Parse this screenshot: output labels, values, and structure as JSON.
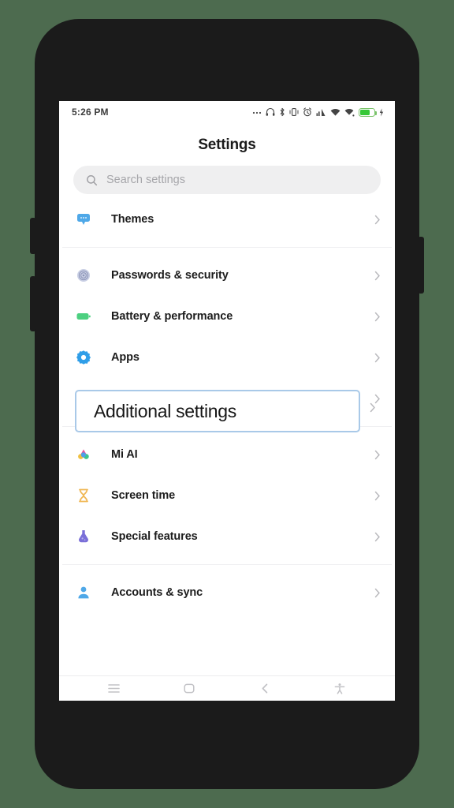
{
  "device": {
    "frame_color": "#1b1b1b",
    "background_color": "#4d6b4f"
  },
  "status_bar": {
    "time": "5:26 PM",
    "icons": [
      "more-ellipsis-icon",
      "headphones-icon",
      "bluetooth-icon",
      "vibrate-icon",
      "alarm-icon",
      "signal-icon",
      "wifi-icon",
      "wifi-calling-icon",
      "battery-icon",
      "charging-bolt-icon"
    ],
    "battery_color": "#37c837",
    "battery_level_percent": 72
  },
  "header": {
    "title": "Settings"
  },
  "search": {
    "placeholder": "Search settings",
    "icon": "search-icon",
    "value": ""
  },
  "list": {
    "groups": [
      {
        "items": [
          {
            "label": "Themes",
            "icon": "themes-icon",
            "icon_color": "#4fa8e8",
            "chevron": "chevron-right-icon"
          }
        ]
      },
      {
        "items": [
          {
            "label": "Passwords & security",
            "icon": "fingerprint-icon",
            "icon_color": "#9aa3c4",
            "chevron": "chevron-right-icon"
          },
          {
            "label": "Battery & performance",
            "icon": "battery-icon",
            "icon_color": "#4cd080",
            "chevron": "chevron-right-icon"
          },
          {
            "label": "Apps",
            "icon": "gear-icon",
            "icon_color": "#2f9ee8",
            "chevron": "chevron-right-icon"
          },
          {
            "label": "Additional settings",
            "icon": "sliders-icon",
            "icon_color": "#6fb7e8",
            "chevron": "chevron-right-icon"
          }
        ]
      },
      {
        "items": [
          {
            "label": "Mi AI",
            "icon": "mi-ai-icon",
            "icon_color": "#e8559a",
            "chevron": "chevron-right-icon"
          },
          {
            "label": "Screen time",
            "icon": "hourglass-icon",
            "icon_color": "#f0b856",
            "chevron": "chevron-right-icon"
          },
          {
            "label": "Special features",
            "icon": "flask-icon",
            "icon_color": "#7a6fd8",
            "chevron": "chevron-right-icon"
          }
        ]
      },
      {
        "items": [
          {
            "label": "Accounts & sync",
            "icon": "account-icon",
            "icon_color": "#4fa8e8",
            "chevron": "chevron-right-icon"
          }
        ]
      }
    ]
  },
  "highlight": {
    "label": "Additional settings",
    "border_color": "#a9c9e8",
    "chevron": "chevron-right-icon"
  },
  "navbar": {
    "buttons": [
      {
        "name": "recents-button",
        "icon": "menu-icon"
      },
      {
        "name": "home-button",
        "icon": "home-square-icon"
      },
      {
        "name": "back-button",
        "icon": "chevron-left-icon"
      },
      {
        "name": "accessibility-button",
        "icon": "accessibility-icon"
      }
    ]
  }
}
